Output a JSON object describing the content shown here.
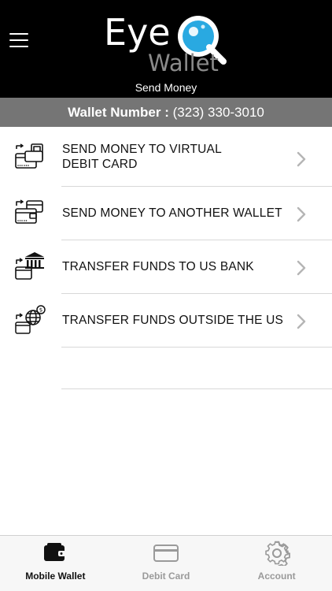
{
  "app": {
    "logo_text_eye": "Eye",
    "logo_text_wallet": "Wallet",
    "screen_title": "Send Money"
  },
  "wallet": {
    "label": "Wallet Number :",
    "number": "(323) 330-3010"
  },
  "menu_items": [
    {
      "line1": "SEND MONEY TO VIRTUAL",
      "line2": "DEBIT CARD",
      "icon": "wallet-to-card-icon"
    },
    {
      "label": "SEND MONEY TO ANOTHER WALLET",
      "icon": "wallet-to-wallet-icon"
    },
    {
      "label": "TRANSFER FUNDS TO US BANK",
      "icon": "wallet-to-bank-icon"
    },
    {
      "label": "TRANSFER FUNDS OUTSIDE THE US",
      "icon": "wallet-to-globe-icon"
    }
  ],
  "tabbar": {
    "tabs": [
      {
        "label": "Mobile Wallet",
        "icon": "wallet-icon",
        "active": true
      },
      {
        "label": "Debit Card",
        "icon": "credit-card-icon",
        "active": false
      },
      {
        "label": "Account",
        "icon": "gear-icon",
        "active": false
      }
    ]
  },
  "colors": {
    "header_bg": "#000000",
    "wallet_bar_bg": "#757575",
    "accent_blue": "#29a9e1",
    "divider": "#d8d8d8",
    "inactive_tab": "#9a9a9a"
  }
}
